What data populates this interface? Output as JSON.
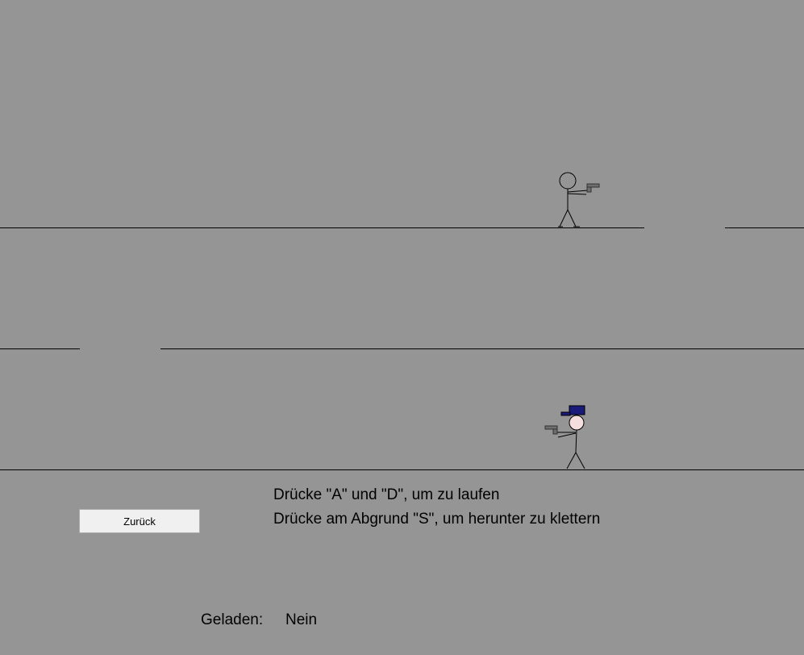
{
  "colors": {
    "background": "#959595",
    "line": "#000000",
    "gun": "#6e6e6e",
    "cap": "#1a1a7a",
    "face": "#f5dede",
    "button_bg": "#f0f0f0"
  },
  "instructions": {
    "walk": "Drücke \"A\" und \"D\", um zu laufen",
    "climb": "Drücke am Abgrund \"S\", um herunter zu klettern"
  },
  "back_button": {
    "label": "Zurück"
  },
  "status": {
    "loaded_label": "Geladen:",
    "loaded_value": "Nein"
  },
  "entities": {
    "enemy": "stick-figure-with-pistol-facing-right",
    "player": "stick-figure-with-blue-cap-and-pistol-facing-left"
  }
}
